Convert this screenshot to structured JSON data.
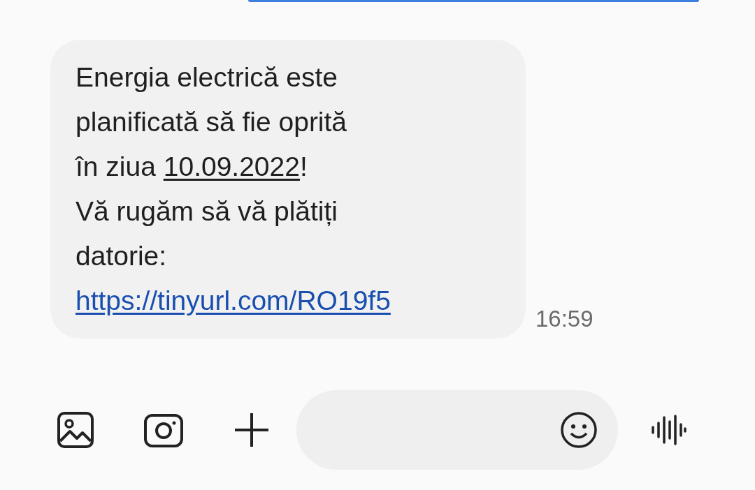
{
  "message": {
    "parts": [
      {
        "kind": "text",
        "text": "Energia electrică este\nplanificată să fie oprită\nîn ziua "
      },
      {
        "kind": "date",
        "text": "10.09.2022"
      },
      {
        "kind": "text",
        "text": "!\nVă rugăm să vă plătiți\ndatorie: "
      },
      {
        "kind": "link",
        "text": "https://tinyurl.com/RO19f5"
      }
    ],
    "time": "16:59"
  }
}
